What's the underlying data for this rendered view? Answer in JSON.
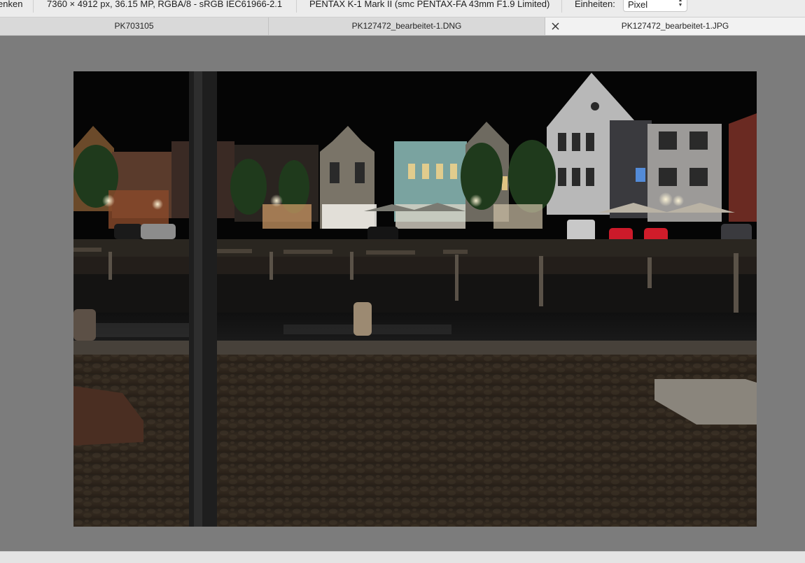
{
  "infobar": {
    "truncated_label": "enken",
    "dimensions": "7360 × 4912 px, 36.15 MP, RGBA/8 - sRGB IEC61966-2.1",
    "camera": "PENTAX K-1 Mark II (smc PENTAX-FA 43mm F1.9 Limited)",
    "units_label": "Einheiten:",
    "units_value": "Pixel"
  },
  "tabs": [
    {
      "label": "PK703105",
      "active": false
    },
    {
      "label": "PK127472_bearbeitet-1.DNG",
      "active": false
    },
    {
      "label": "PK127472_bearbeitet-1.JPG",
      "active": true
    }
  ],
  "icons": {
    "close": "close-icon",
    "select_arrows": "chevron-updown-icon"
  },
  "colors": {
    "canvas_bg": "#7c7c7c",
    "tab_active_bg": "#f2f2f2",
    "tab_inactive_bg": "#d9d9d9"
  }
}
